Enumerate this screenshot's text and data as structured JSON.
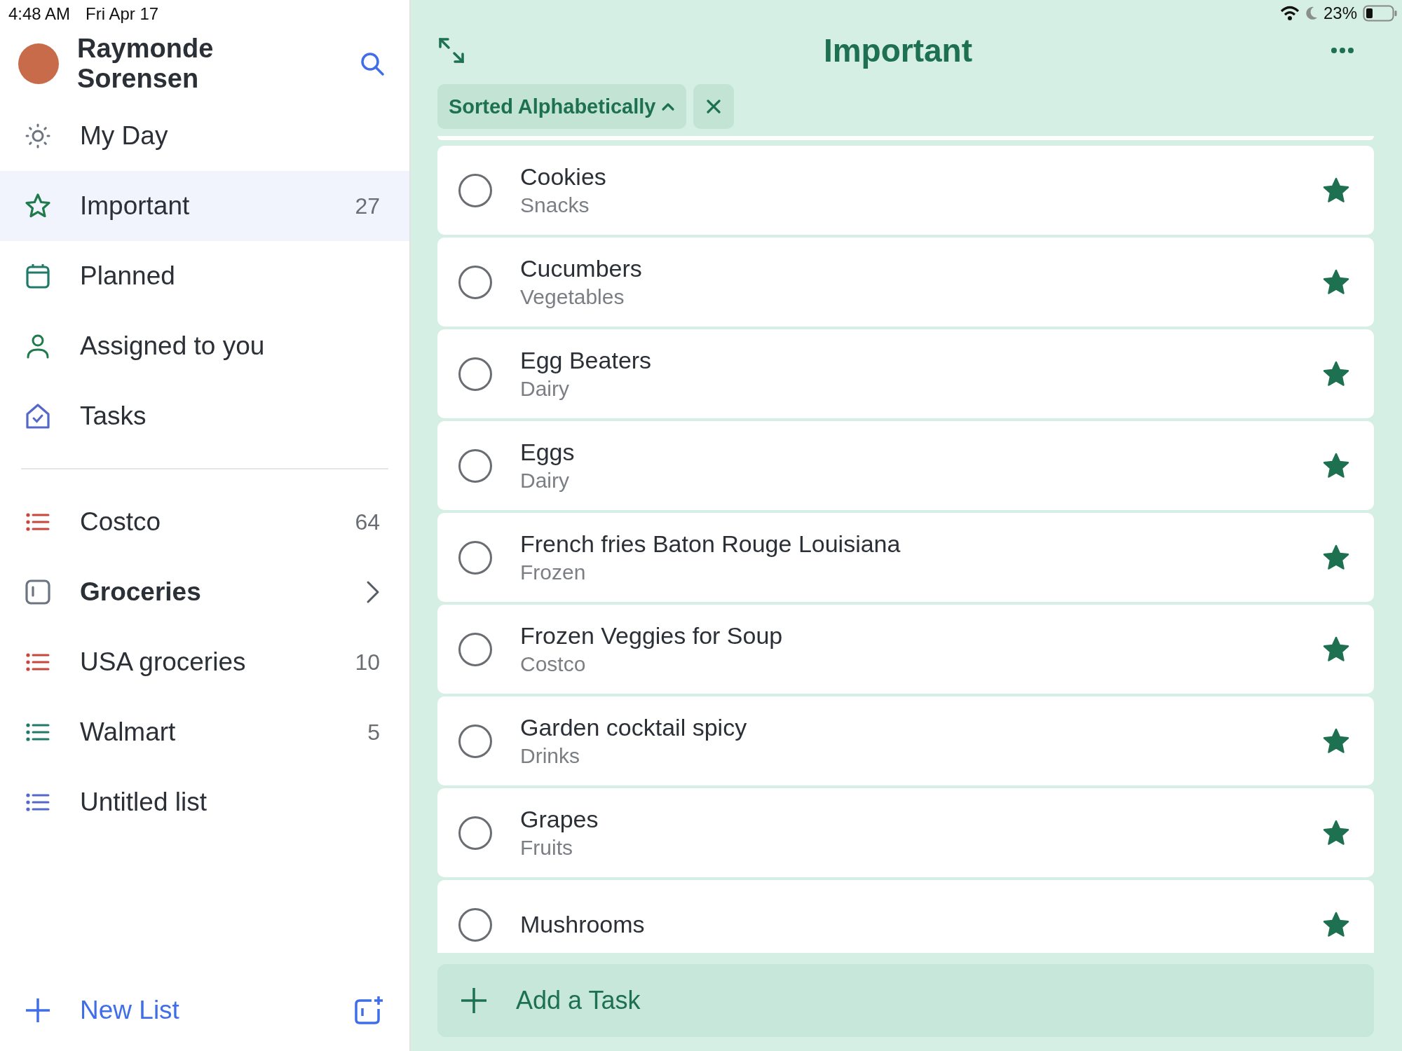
{
  "status_bar": {
    "time": "4:48 AM",
    "date": "Fri Apr 17",
    "battery": "23%"
  },
  "sidebar": {
    "user_name": "Raymonde Sorensen",
    "smart_lists": [
      {
        "kind": "sun",
        "label": "My Day",
        "selected": false
      },
      {
        "kind": "star",
        "label": "Important",
        "count": "27",
        "selected": true
      },
      {
        "kind": "calendar",
        "label": "Planned",
        "selected": false
      },
      {
        "kind": "person",
        "label": "Assigned to you",
        "selected": false
      },
      {
        "kind": "home",
        "label": "Tasks",
        "selected": false
      }
    ],
    "lists": [
      {
        "kind": "list",
        "label": "Costco",
        "count": "64",
        "color": "#c8463c"
      },
      {
        "kind": "group",
        "label": "Groceries"
      },
      {
        "kind": "list",
        "label": "USA groceries",
        "count": "10",
        "color": "#c8463c"
      },
      {
        "kind": "list",
        "label": "Walmart",
        "count": "5",
        "color": "#1f7a6a"
      },
      {
        "kind": "list",
        "label": "Untitled list",
        "color": "#5468c9"
      }
    ],
    "new_list": "New List"
  },
  "main": {
    "title": "Important",
    "sort_chip": "Sorted Alphabetically",
    "tasks": [
      {
        "title": "Cookies",
        "list": "Snacks",
        "completed": false,
        "important": true
      },
      {
        "title": "Cucumbers",
        "list": "Vegetables",
        "completed": false,
        "important": true
      },
      {
        "title": "Egg Beaters",
        "list": "Dairy",
        "completed": false,
        "important": true
      },
      {
        "title": "Eggs",
        "list": "Dairy",
        "completed": false,
        "important": true
      },
      {
        "title": "French fries Baton Rouge Louisiana",
        "list": "Frozen",
        "completed": false,
        "important": true
      },
      {
        "title": "Frozen Veggies for Soup",
        "list": "Costco",
        "completed": false,
        "important": true
      },
      {
        "title": "Garden cocktail spicy",
        "list": "Drinks",
        "completed": false,
        "important": true
      },
      {
        "title": "Grapes",
        "list": "Fruits",
        "completed": false,
        "important": true
      },
      {
        "title": "Mushrooms",
        "completed": false,
        "important": true
      }
    ],
    "add_task": "Add a Task"
  }
}
